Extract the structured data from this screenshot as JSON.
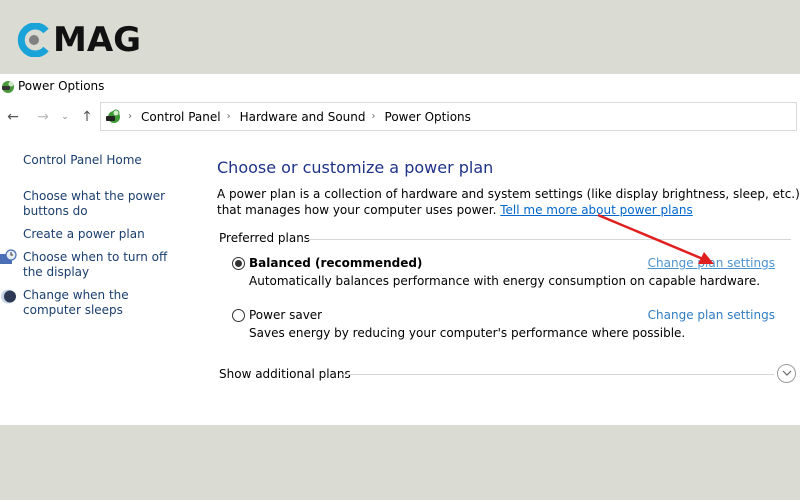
{
  "logo": {
    "text": "MAG",
    "mark": "c-ring-logo",
    "brand_color": "#1aa3d9",
    "dot_color": "#808080"
  },
  "window": {
    "title": "Power Options",
    "icon": "power-options-icon"
  },
  "navbar": {
    "back": "←",
    "forward": "→",
    "recent": "⌄",
    "up": "↑",
    "breadcrumb": [
      "Control Panel",
      "Hardware and Sound",
      "Power Options"
    ],
    "separator": "›"
  },
  "sidebar": {
    "items": [
      {
        "label": "Control Panel Home",
        "icon": null
      },
      {
        "label": "Choose what the power buttons do",
        "icon": null
      },
      {
        "label": "Create a power plan",
        "icon": null
      },
      {
        "label": "Choose when to turn off the display",
        "icon": "display-clock-icon"
      },
      {
        "label": "Change when the computer sleeps",
        "icon": "sleep-moon-icon"
      }
    ]
  },
  "main": {
    "heading": "Choose or customize a power plan",
    "description": "A power plan is a collection of hardware and system settings (like display brightness, sleep, etc.) that manages how your computer uses power. ",
    "learn_more_link": "Tell me more about power plans",
    "preferred_label": "Preferred plans",
    "plans": [
      {
        "name": "Balanced (recommended)",
        "selected": true,
        "description": "Automatically balances performance with energy consumption on capable hardware.",
        "link": "Change plan settings"
      },
      {
        "name": "Power saver",
        "selected": false,
        "description": "Saves energy by reducing your computer's performance where possible.",
        "link": "Change plan settings"
      }
    ],
    "additional_label": "Show additional plans"
  },
  "annotation": {
    "type": "arrow",
    "color": "#e02020",
    "target": "Change plan settings"
  }
}
